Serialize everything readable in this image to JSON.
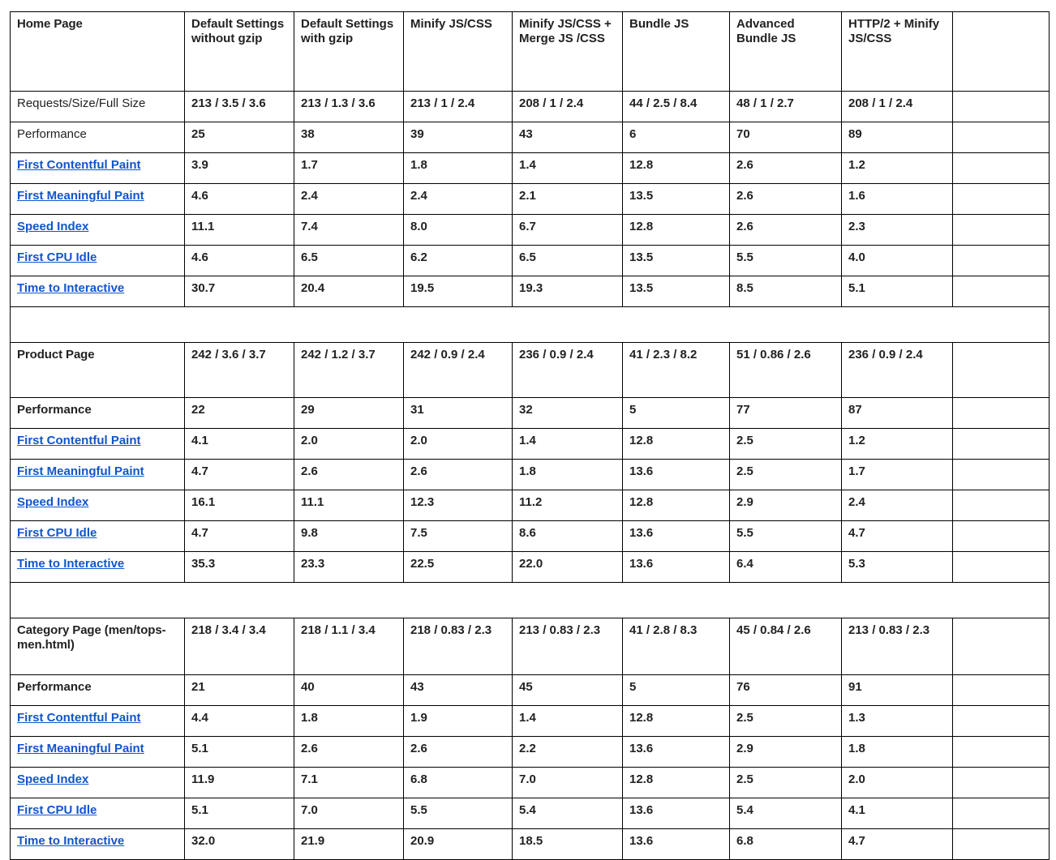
{
  "table": {
    "columns": [
      "Default Settings without  gzip",
      "Default Settings with gzip",
      "Minify JS/CSS",
      "Minify JS/CSS + Merge JS /CSS",
      "Bundle JS",
      "Advanced Bundle JS",
      "HTTP/2 + Minify JS/CSS",
      ""
    ],
    "row_labels": {
      "requests": "Requests/Size/Full Size",
      "performance": "Performance",
      "fcp": "First Contentful Paint",
      "fmp": "First Meaningful Paint",
      "si": "Speed Index",
      "cpu": "First CPU Idle",
      "tti": "Time to Interactive"
    },
    "colors": {
      "red": "#b32222",
      "orange": "#e8840c",
      "green": "#0c7a3e",
      "link": "#1155cc",
      "dark": "#1a1a1a"
    }
  },
  "sections": [
    {
      "title": "Home Page",
      "title_in_header_row": true,
      "requests": [
        "213 / 3.5 / 3.6",
        "213 / 1.3 / 3.6",
        "213 / 1 / 2.4",
        "208 / 1 / 2.4",
        "44 / 2.5 / 8.4",
        "48 / 1 / 2.7",
        "208 / 1 / 2.4",
        ""
      ],
      "performance": [
        "25",
        "38",
        "39",
        "43",
        "6",
        "70",
        "89",
        ""
      ],
      "performance_colors": [
        "dark",
        "dark",
        "dark",
        "dark",
        "dark",
        "dark",
        "dark",
        "dark"
      ],
      "metrics": [
        {
          "label": "First Contentful Paint",
          "values": [
            "3.9",
            "1.7",
            "1.8",
            "1.4",
            "12.8",
            "2.6",
            "1.2",
            ""
          ],
          "colors": [
            "orange",
            "green",
            "green",
            "green",
            "red",
            "orange",
            "green",
            "dark"
          ]
        },
        {
          "label": "First Meaningful Paint",
          "values": [
            "4.6",
            "2.4",
            "2.4",
            "2.1",
            "13.5",
            "2.6",
            "1.6",
            ""
          ],
          "colors": [
            "red",
            "orange",
            "orange",
            "green",
            "red",
            "orange",
            "green",
            "dark"
          ]
        },
        {
          "label": "Speed Index",
          "values": [
            "11.1",
            "7.4",
            "8.0",
            "6.7",
            "12.8",
            "2.6",
            "2.3",
            ""
          ],
          "colors": [
            "red",
            "red",
            "red",
            "red",
            "red",
            "green",
            "green",
            "dark"
          ]
        },
        {
          "label": "First CPU Idle",
          "values": [
            "4.6",
            "6.5",
            "6.2",
            "6.5",
            "13.5",
            "5.5",
            "4.0",
            ""
          ],
          "colors": [
            "orange",
            "orange",
            "orange",
            "red",
            "red",
            "orange",
            "orange",
            "dark"
          ]
        },
        {
          "label": "Time to Interactive",
          "values": [
            "30.7",
            "20.4",
            "19.5",
            "19.3",
            "13.5",
            "8.5",
            "5.1",
            ""
          ],
          "colors": [
            "red",
            "red",
            "red",
            "red",
            "red",
            "red",
            "orange",
            "dark"
          ]
        }
      ]
    },
    {
      "title": "Product Page",
      "title_in_header_row": false,
      "requests": [
        "242 / 3.6 / 3.7",
        "242 / 1.2 / 3.7",
        "242 / 0.9 / 2.4",
        "236 / 0.9 / 2.4",
        "41 / 2.3 / 8.2",
        "51 / 0.86 / 2.6",
        "236 / 0.9 / 2.4",
        ""
      ],
      "performance": [
        "22",
        "29",
        "31",
        "32",
        "5",
        "77",
        "87",
        ""
      ],
      "performance_colors": [
        "dark",
        "dark",
        "dark",
        "dark",
        "dark",
        "dark",
        "dark",
        "dark"
      ],
      "metrics": [
        {
          "label": "First Contentful Paint",
          "values": [
            "4.1",
            "2.0",
            "2.0",
            "1.4",
            "12.8",
            "2.5",
            "1.2",
            ""
          ],
          "colors": [
            "red",
            "green",
            "green",
            "green",
            "red",
            "orange",
            "green",
            "dark"
          ]
        },
        {
          "label": "First Meaningful Paint",
          "values": [
            "4.7",
            "2.6",
            "2.6",
            "1.8",
            "13.6",
            "2.5",
            "1.7",
            ""
          ],
          "colors": [
            "red",
            "orange",
            "orange",
            "green",
            "red",
            "orange",
            "green",
            "dark"
          ]
        },
        {
          "label": "Speed Index",
          "values": [
            "16.1",
            "11.1",
            "12.3",
            "11.2",
            "12.8",
            "2.9",
            "2.4",
            ""
          ],
          "colors": [
            "red",
            "red",
            "red",
            "red",
            "red",
            "green",
            "green",
            "dark"
          ]
        },
        {
          "label": "First CPU Idle",
          "values": [
            "4.7",
            "9.8",
            "7.5",
            "8.6",
            "13.6",
            "5.5",
            "4.7",
            ""
          ],
          "colors": [
            "orange",
            "red",
            "red",
            "red",
            "red",
            "orange",
            "orange",
            "dark"
          ]
        },
        {
          "label": "Time to Interactive",
          "values": [
            "35.3",
            "23.3",
            "22.5",
            "22.0",
            "13.6",
            "6.4",
            "5.3",
            ""
          ],
          "colors": [
            "red",
            "red",
            "red",
            "red",
            "red",
            "orange",
            "orange",
            "dark"
          ]
        }
      ]
    },
    {
      "title": "Category Page (men/tops-men.html)",
      "title_in_header_row": false,
      "requests": [
        "218 / 3.4 / 3.4",
        "218 / 1.1 / 3.4",
        "218 / 0.83 / 2.3",
        "213 / 0.83 / 2.3",
        "41 / 2.8 / 8.3",
        "45 / 0.84 / 2.6",
        "213 / 0.83 / 2.3",
        ""
      ],
      "performance": [
        "21",
        "40",
        "43",
        "45",
        "5",
        "76",
        "91",
        ""
      ],
      "performance_colors": [
        "dark",
        "green",
        "dark",
        "dark",
        "dark",
        "dark",
        "dark",
        "dark"
      ],
      "metrics": [
        {
          "label": "First Contentful Paint",
          "values": [
            "4.4",
            "1.8",
            "1.9",
            "1.4",
            "12.8",
            "2.5",
            "1.3",
            ""
          ],
          "colors": [
            "red",
            "green",
            "green",
            "green",
            "red",
            "orange",
            "green",
            "dark"
          ]
        },
        {
          "label": "First Meaningful Paint",
          "values": [
            "5.1",
            "2.6",
            "2.6",
            "2.2",
            "13.6",
            "2.9",
            "1.8",
            ""
          ],
          "colors": [
            "red",
            "orange",
            "orange",
            "green",
            "red",
            "orange",
            "green",
            "dark"
          ]
        },
        {
          "label": "Speed Index",
          "values": [
            "11.9",
            "7.1",
            "6.8",
            "7.0",
            "12.8",
            "2.5",
            "2.0",
            ""
          ],
          "colors": [
            "red",
            "red",
            "red",
            "red",
            "red",
            "green",
            "green",
            "dark"
          ]
        },
        {
          "label": "First CPU Idle",
          "values": [
            "5.1",
            "7.0",
            "5.5",
            "5.4",
            "13.6",
            "5.4",
            "4.1",
            ""
          ],
          "colors": [
            "orange",
            "red",
            "orange",
            "orange",
            "red",
            "orange",
            "orange",
            "dark"
          ]
        },
        {
          "label": "Time to Interactive",
          "values": [
            "32.0",
            "21.9",
            "20.9",
            "18.5",
            "13.6",
            "6.8",
            "4.7",
            ""
          ],
          "colors": [
            "red",
            "red",
            "red",
            "red",
            "red",
            "orange",
            "orange",
            "dark"
          ]
        }
      ]
    }
  ]
}
